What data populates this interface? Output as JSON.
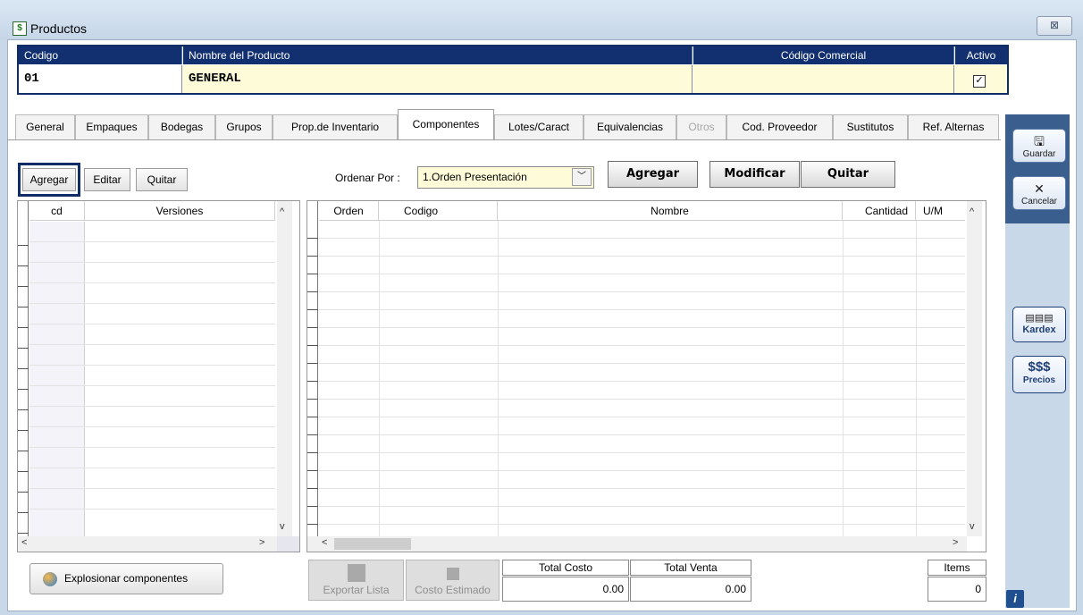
{
  "window": {
    "title": "Productos",
    "icon": "dollar-doc-icon",
    "close": "⊠"
  },
  "header": {
    "columns": [
      "Codigo",
      "Nombre del Producto",
      "Código Comercial",
      "Activo"
    ],
    "values": {
      "codigo": "01",
      "nombre": "GENERAL",
      "codigo_comercial": "",
      "activo": true
    }
  },
  "tabs": [
    {
      "label": "General"
    },
    {
      "label": "Empaques"
    },
    {
      "label": "Bodegas"
    },
    {
      "label": "Grupos"
    },
    {
      "label": "Prop.de Inventario"
    },
    {
      "label": "Componentes"
    },
    {
      "label": "Lotes/Caract"
    },
    {
      "label": "Equivalencias"
    },
    {
      "label": "Otros"
    },
    {
      "label": "Cod. Proveedor"
    },
    {
      "label": "Sustitutos"
    },
    {
      "label": "Ref. Alternas"
    }
  ],
  "active_tab": "Componentes",
  "sidebar": {
    "guardar": "Guardar",
    "cancelar": "Cancelar",
    "kardex": "Kardex",
    "precios": "Precios",
    "precios_glyph": "$$$"
  },
  "versions": {
    "add": "Agregar",
    "edit": "Editar",
    "remove": "Quitar",
    "columns": [
      "cd",
      "Versiones"
    ]
  },
  "components": {
    "sort_label": "Ordenar Por :",
    "sort_value": "1.Orden Presentación",
    "add": "Agregar",
    "modify": "Modificar",
    "remove": "Quitar",
    "columns": [
      "Orden",
      "Codigo",
      "Nombre",
      "Cantidad",
      "U/M"
    ]
  },
  "footer": {
    "explode": "Explosionar componentes",
    "export": "Exportar Lista",
    "estimate": "Costo Estimado",
    "total_cost_label": "Total Costo",
    "total_cost": "0.00",
    "total_sale_label": "Total Venta",
    "total_sale": "0.00",
    "items_label": "Items",
    "items": "0"
  },
  "colors": {
    "header_bg": "#12306f",
    "field_bg": "#fefcd8",
    "panel_bg": "#c9d8e8"
  }
}
